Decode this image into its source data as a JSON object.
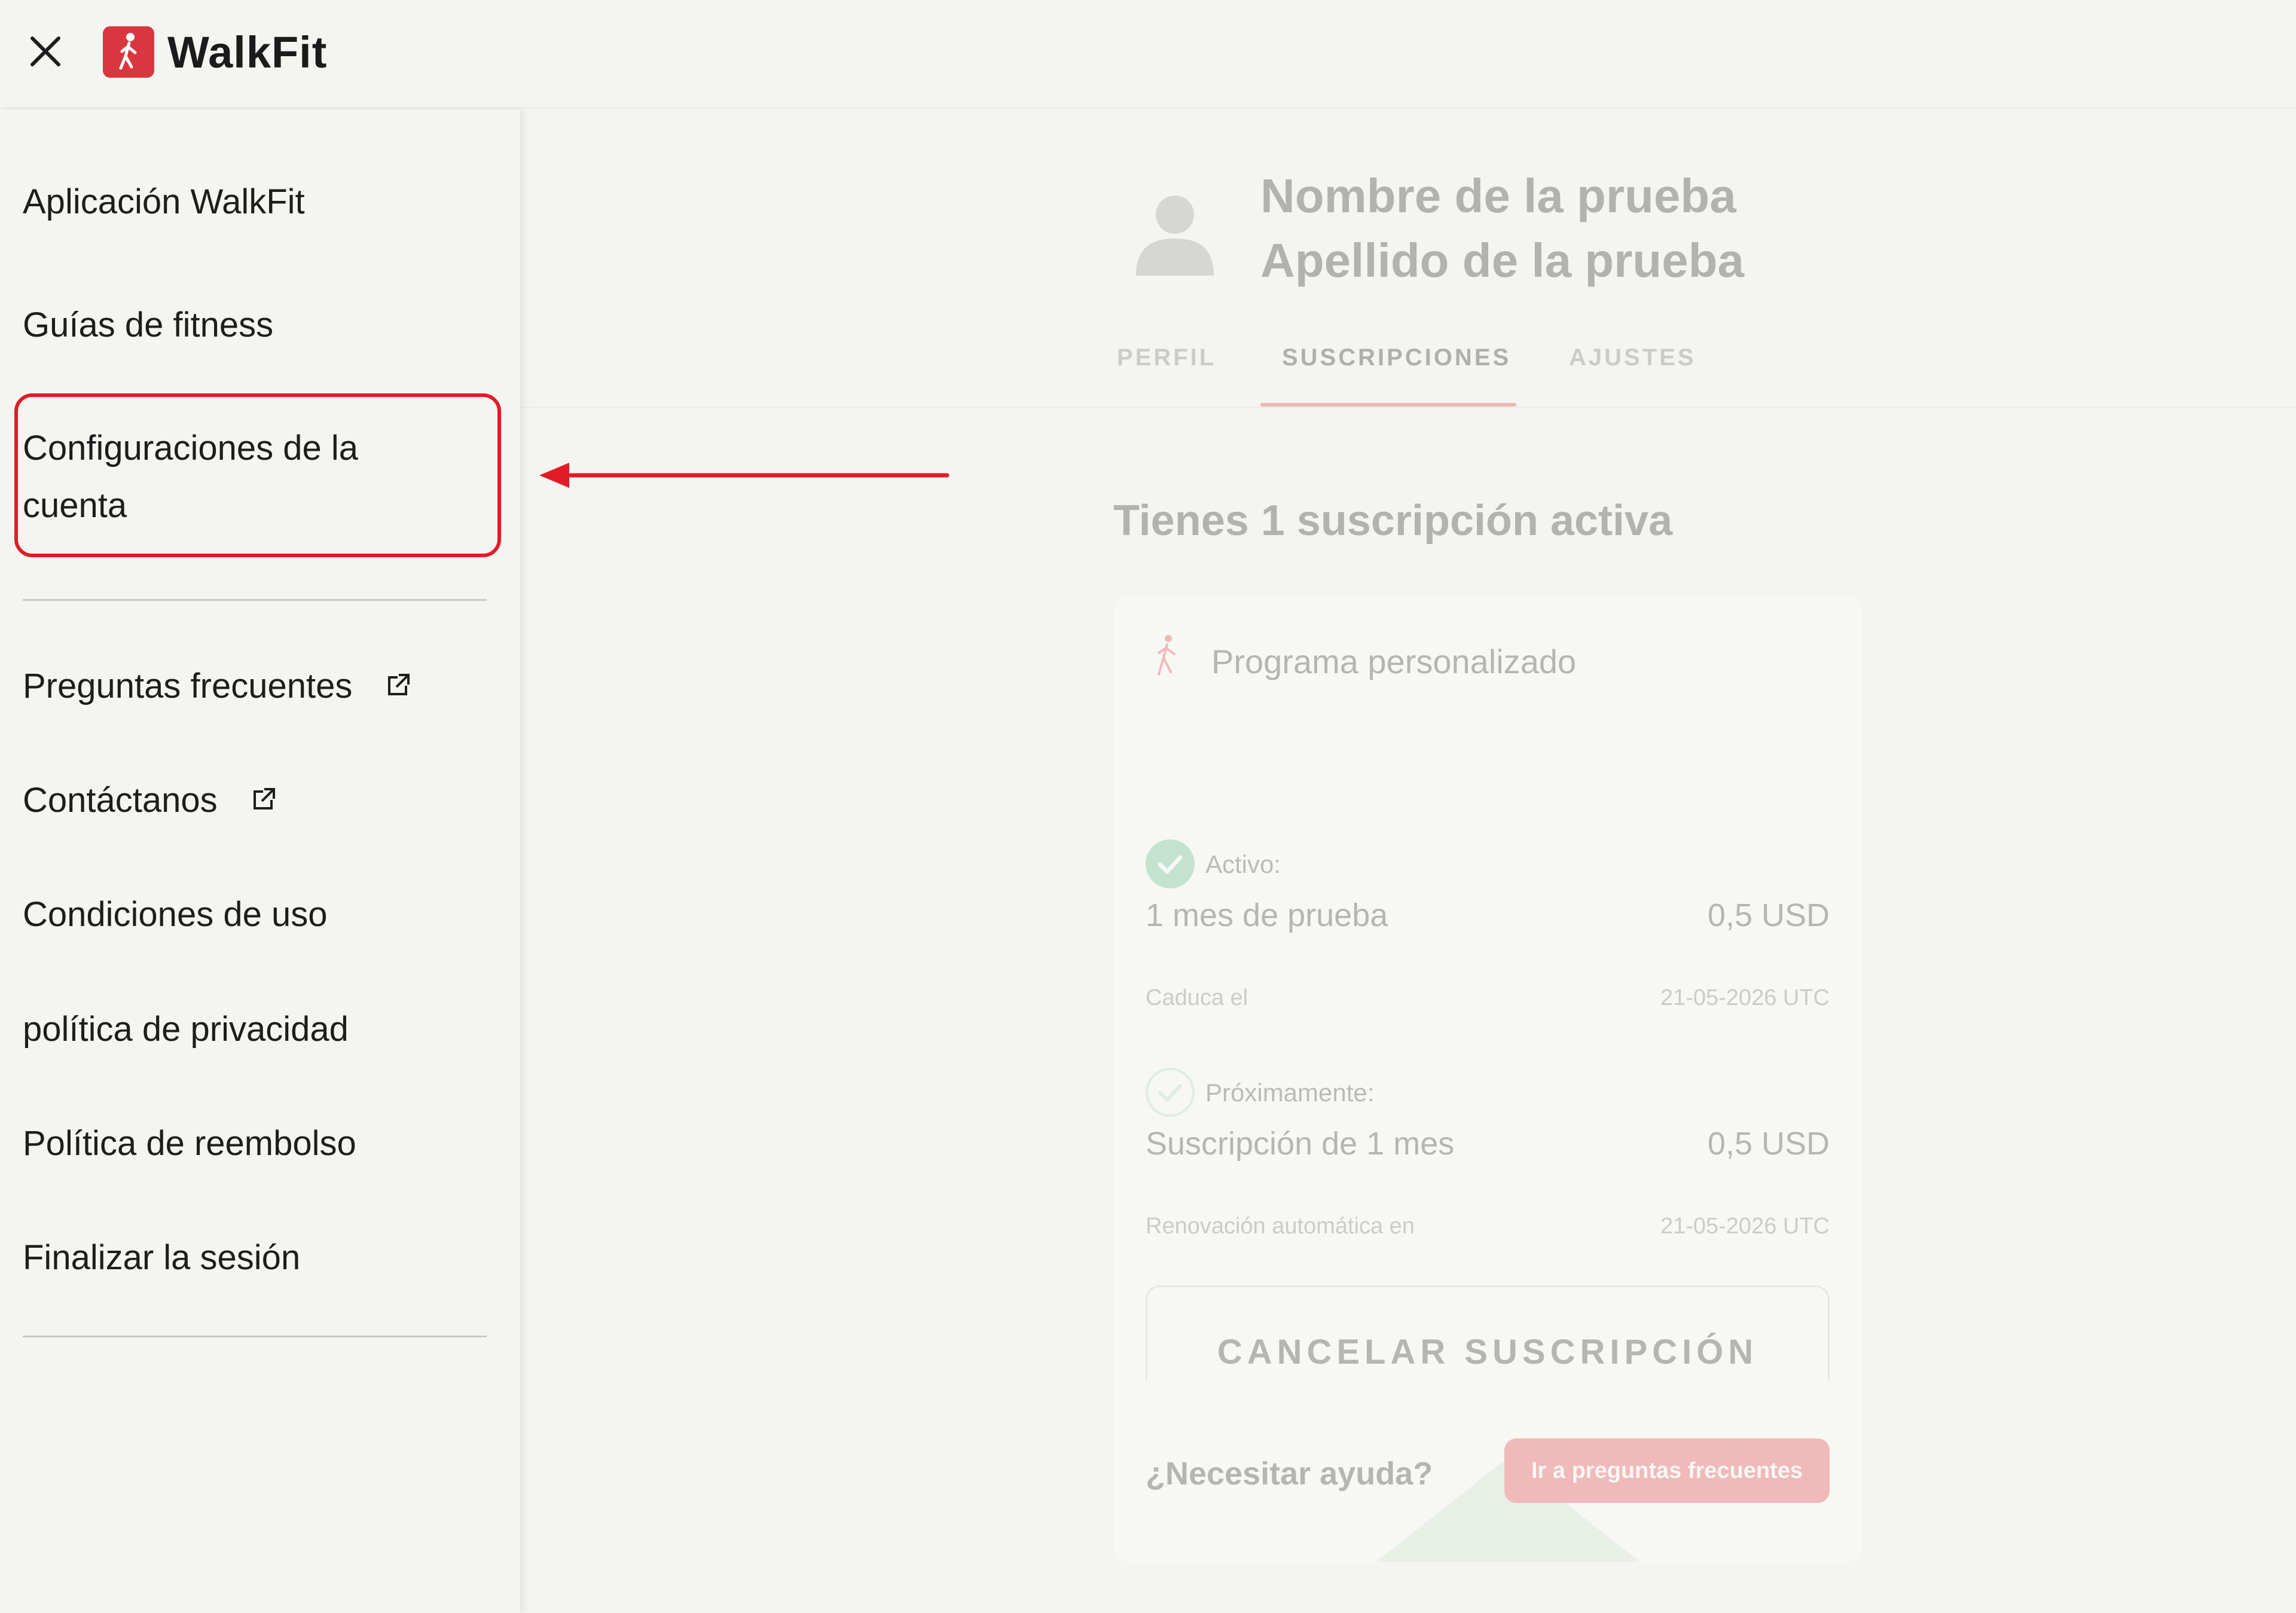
{
  "header": {
    "app_name": "WalkFit",
    "brand_color": "#d8373f"
  },
  "sidebar": {
    "items": [
      {
        "label": "Aplicación WalkFit"
      },
      {
        "label": "Guías de fitness"
      },
      {
        "label": "Configuraciones de la cuenta"
      },
      {
        "label": "Preguntas frecuentes",
        "icon": "external-link-icon"
      },
      {
        "label": "Contáctanos",
        "icon": "external-link-icon"
      },
      {
        "label": "Condiciones de uso"
      },
      {
        "label": "política de privacidad"
      },
      {
        "label": "Política de reembolso"
      },
      {
        "label": "Finalizar la sesión"
      }
    ],
    "highlighted_item": "Configuraciones de la cuenta",
    "highlight_color": "#e11b25"
  },
  "main": {
    "user": {
      "first_name": "Nombre de la prueba",
      "last_name": "Apellido de la prueba"
    },
    "tabs": [
      {
        "label": "PERFIL"
      },
      {
        "label": "SUSCRIPCIONES",
        "active": true
      },
      {
        "label": "AJUSTES"
      }
    ],
    "subscriptions": {
      "heading": "Tienes 1 suscripción activa",
      "program_title": "Programa personalizado",
      "active": {
        "status_label": "Activo:",
        "plan": "1 mes de prueba",
        "price": "0,5 USD",
        "meta_label": "Caduca el",
        "meta_value": "21-05-2026 UTC"
      },
      "upcoming": {
        "status_label": "Próximamente:",
        "plan": "Suscripción de 1 mes",
        "price": "0,5 USD",
        "meta_label": "Renovación automática en",
        "meta_value": "21-05-2026 UTC"
      },
      "cancel_button": "CANCELAR SUSCRIPCIÓN"
    },
    "help": {
      "text": "¿Necesitar ayuda?",
      "button": "Ir a preguntas frecuentes"
    }
  },
  "colors": {
    "accent": "#e8424c",
    "success": "#5fc28e"
  }
}
